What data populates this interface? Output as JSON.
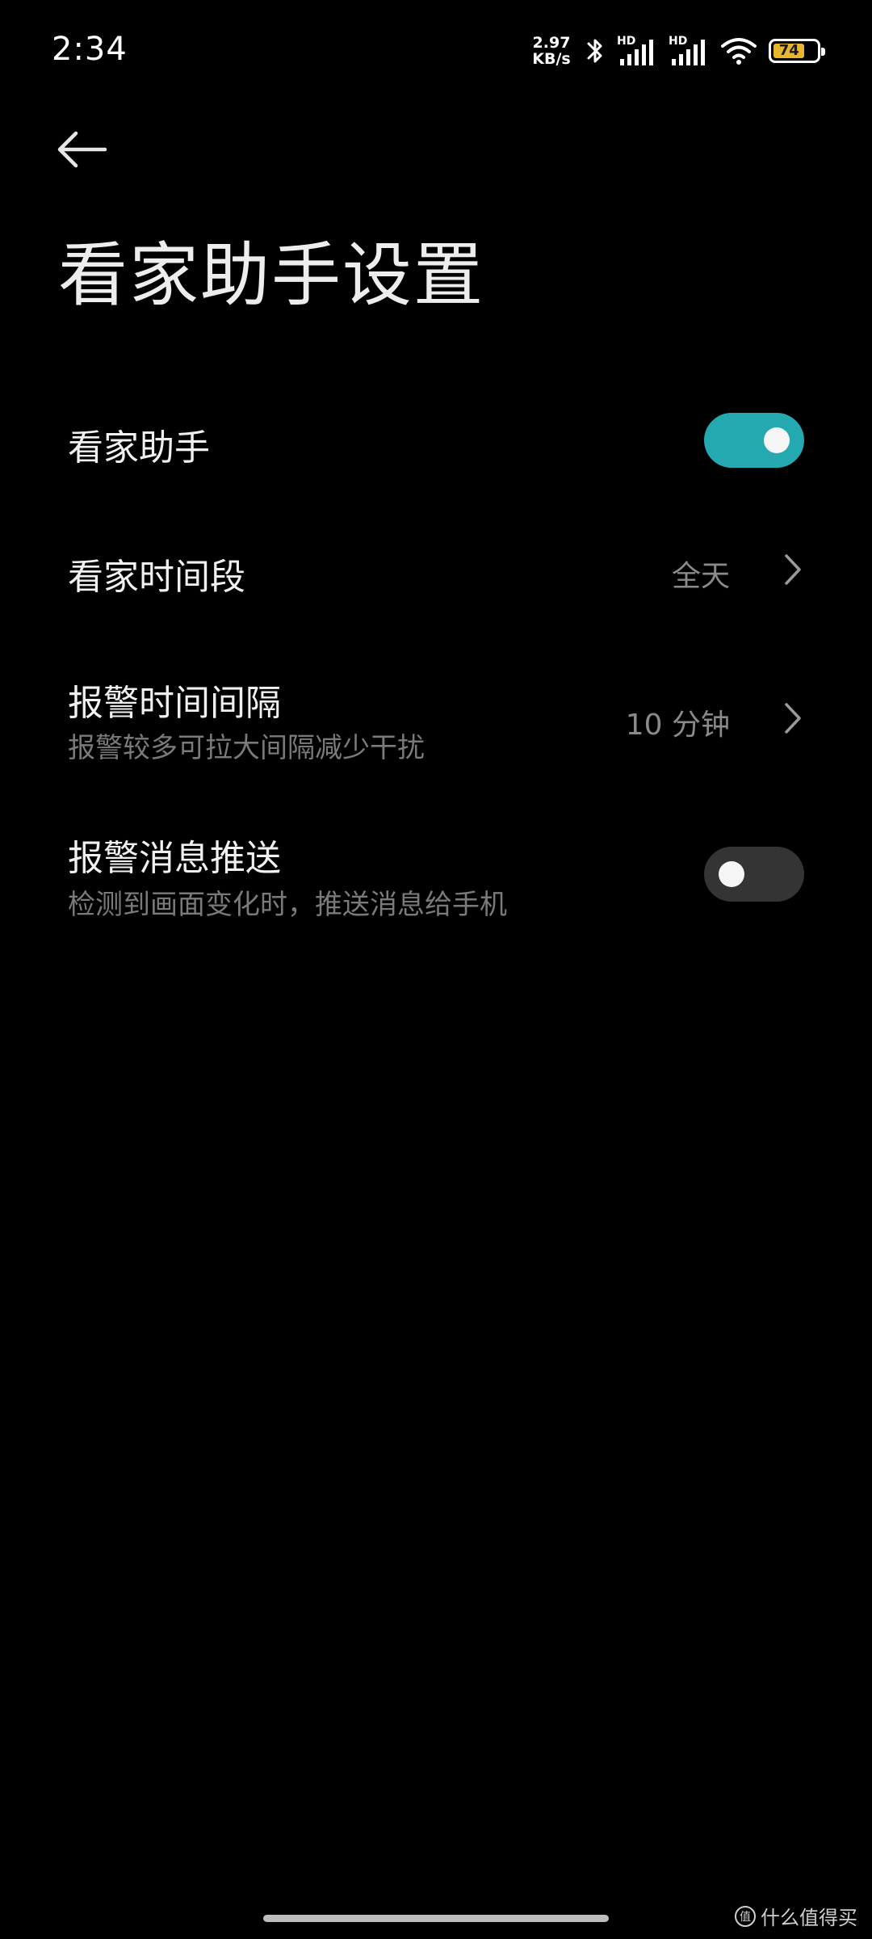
{
  "status_bar": {
    "time": "2:34",
    "net_speed_value": "2.97",
    "net_speed_unit": "KB/s",
    "sim1_label": "HD",
    "sim2_label": "HD",
    "battery_level": "74",
    "battery_color": "#e8b62c"
  },
  "header": {
    "title": "看家助手设置"
  },
  "settings": {
    "assistant": {
      "title": "看家助手",
      "enabled": true
    },
    "time_period": {
      "title": "看家时间段",
      "value": "全天"
    },
    "alarm_interval": {
      "title": "报警时间间隔",
      "subtitle": "报警较多可拉大间隔减少干扰",
      "value": "10 分钟"
    },
    "alarm_push": {
      "title": "报警消息推送",
      "subtitle": "检测到画面变化时，推送消息给手机",
      "enabled": false
    }
  },
  "colors": {
    "accent": "#25a9b0",
    "background": "#000000"
  },
  "watermark": {
    "text": "什么值得买",
    "badge": "值"
  }
}
